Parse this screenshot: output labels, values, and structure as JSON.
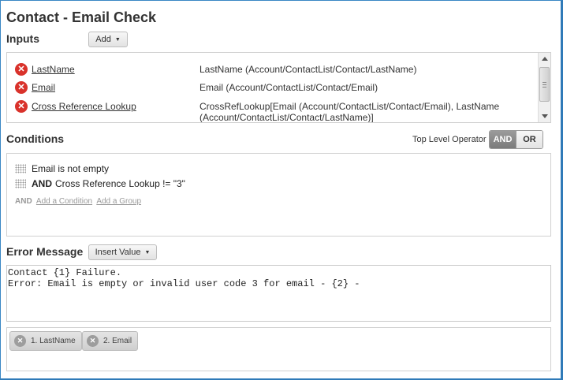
{
  "title": "Contact - Email Check",
  "inputs": {
    "label": "Inputs",
    "add_label": "Add",
    "rows": [
      {
        "name": "LastName",
        "path": "LastName (Account/ContactList/Contact/LastName)"
      },
      {
        "name": "Email",
        "path": "Email (Account/ContactList/Contact/Email)"
      },
      {
        "name": "Cross Reference Lookup",
        "path": "CrossRefLookup[Email (Account/ContactList/Contact/Email), LastName (Account/ContactList/Contact/LastName)]"
      }
    ]
  },
  "conditions": {
    "label": "Conditions",
    "top_level_label": "Top Level Operator",
    "op_and": "AND",
    "op_or": "OR",
    "selected_operator": "AND",
    "rows": [
      {
        "operator": "",
        "text": "Email is not empty"
      },
      {
        "operator": "AND",
        "text": "Cross Reference Lookup != \"3\""
      }
    ],
    "footer_operator": "AND",
    "add_condition": "Add a Condition",
    "add_group": "Add a Group"
  },
  "error": {
    "label": "Error Message",
    "insert_label": "Insert Value",
    "message": "Contact {1} Failure.\nError: Email is empty or invalid user code 3 for email - {2} -"
  },
  "tokens": [
    {
      "label": "1. LastName"
    },
    {
      "label": "2. Email"
    }
  ],
  "icons": {
    "remove": "remove-x-icon",
    "caret": "caret-down-icon",
    "drag": "drag-handle-icon",
    "token_remove": "token-remove-icon"
  },
  "colors": {
    "remove_red": "#d9322b",
    "frame_blue": "#2f7ab8",
    "operator_active": "#8a8a8a"
  }
}
